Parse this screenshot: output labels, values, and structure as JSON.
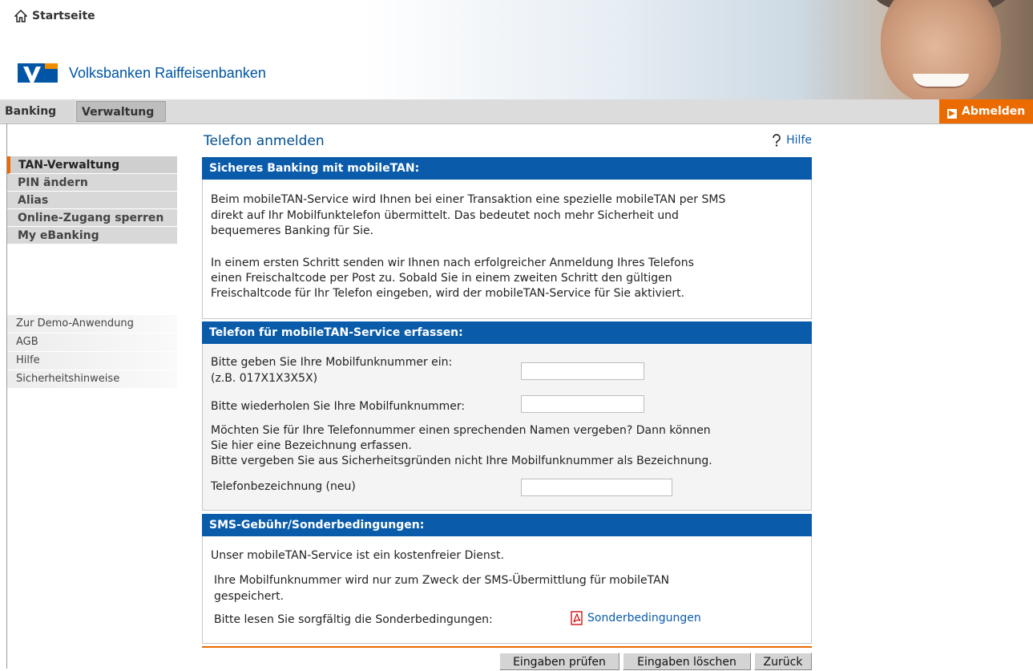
{
  "header": {
    "home_label": "Startseite",
    "brand_name": "Volksbanken Raiffeisenbanken"
  },
  "nav": {
    "tabs": [
      {
        "label": "Banking"
      },
      {
        "label": "Verwaltung"
      }
    ],
    "logout_label": "Abmelden"
  },
  "sidebar": {
    "items": [
      {
        "label": "TAN-Verwaltung"
      },
      {
        "label": "PIN ändern"
      },
      {
        "label": "Alias"
      },
      {
        "label": "Online-Zugang sperren"
      },
      {
        "label": "My eBanking"
      }
    ],
    "links": [
      {
        "label": "Zur Demo-Anwendung"
      },
      {
        "label": "AGB"
      },
      {
        "label": "Hilfe"
      },
      {
        "label": "Sicherheitshinweise"
      }
    ]
  },
  "page": {
    "title": "Telefon anmelden",
    "help_label": "Hilfe"
  },
  "section1": {
    "heading": "Sicheres Banking mit mobileTAN:",
    "para1_lines": [
      "Beim mobileTAN-Service wird Ihnen bei einer Transaktion eine spezielle mobileTAN per SMS",
      "direkt auf Ihr Mobilfunktelefon übermittelt. Das bedeutet noch mehr Sicherheit und",
      "bequemeres Banking für Sie."
    ],
    "para2_lines": [
      "In einem ersten Schritt senden wir Ihnen nach erfolgreicher Anmeldung Ihres Telefons",
      "einen Freischaltcode per Post zu. Sobald Sie in einem zweiten Schritt den gültigen",
      "Freischaltcode für Ihr Telefon eingeben, wird der mobileTAN-Service für Sie aktiviert."
    ]
  },
  "section2": {
    "heading": "Telefon für mobileTAN-Service erfassen:",
    "label_mobile": "Bitte geben Sie Ihre Mobilfunknummer ein:",
    "label_mobile_example": "(z.B. 017X1X3X5X)",
    "label_repeat": "Bitte wiederholen Sie Ihre Mobilfunknummer:",
    "name_lines": [
      "Möchten Sie für Ihre Telefonnummer einen sprechenden Namen vergeben? Dann können",
      "Sie hier eine Bezeichnung erfassen.",
      "Bitte vergeben Sie aus Sicherheitsgründen nicht Ihre Mobilfunknummer als Bezeichnung."
    ],
    "label_name": "Telefonbezeichnung (neu)",
    "mobile_value": "",
    "repeat_value": "",
    "name_value": ""
  },
  "section3": {
    "heading": "SMS-Gebühr/Sonderbedingungen:",
    "free_text": "Unser mobileTAN-Service ist ein kostenfreier Dienst.",
    "storage_lines": [
      "Ihre Mobilfunknummer wird nur zum Zweck der SMS-Übermittlung für mobileTAN",
      "gespeichert."
    ],
    "read_text": "Bitte lesen Sie sorgfältig die Sonderbedingungen:",
    "pdf_link": "Sonderbedingungen"
  },
  "buttons": {
    "check": "Eingaben prüfen",
    "clear": "Eingaben löschen",
    "back": "Zurück"
  },
  "colors": {
    "brand_blue": "#0055a5",
    "section_blue": "#0a5cab",
    "accent_orange": "#ec6b00"
  }
}
